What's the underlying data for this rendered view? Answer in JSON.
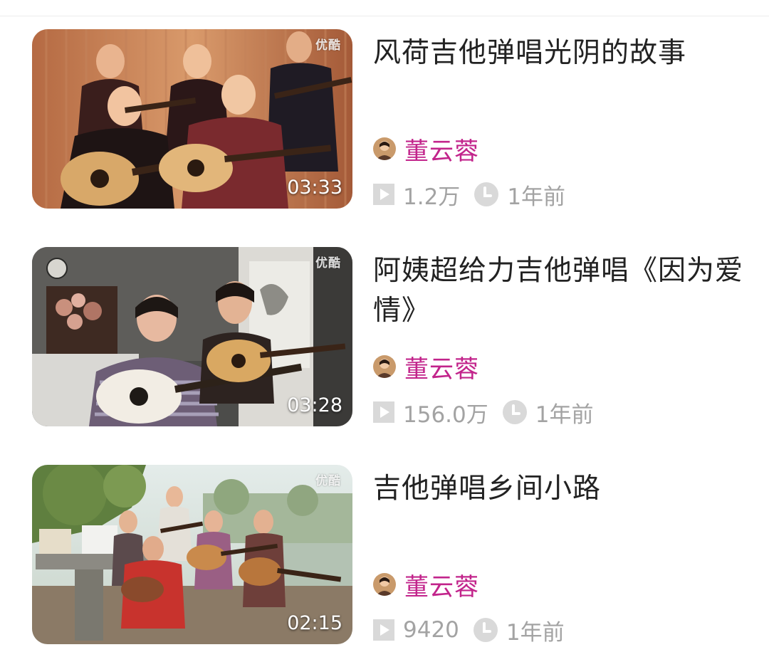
{
  "videos": [
    {
      "title": "风荷吉他弹唱光阴的故事",
      "author": "董云蓉",
      "views": "1.2万",
      "time_ago": "1年前",
      "duration": "03:33",
      "watermark": "优酷",
      "thumbnail_icon": "band-room-curtain-thumbnail"
    },
    {
      "title": "阿姨超给力吉他弹唱《因为爱情》",
      "author": "董云蓉",
      "views": "156.0万",
      "time_ago": "1年前",
      "duration": "03:28",
      "watermark": "优酷",
      "thumbnail_icon": "living-room-duet-thumbnail"
    },
    {
      "title": "吉他弹唱乡间小路",
      "author": "董云蓉",
      "views": "9420",
      "time_ago": "1年前",
      "duration": "02:15",
      "watermark": "优酷",
      "thumbnail_icon": "outdoor-riverside-thumbnail"
    }
  ],
  "colors": {
    "author": "#c2248b",
    "title": "#222222",
    "meta": "#a3a3a3",
    "icon_bg": "#d9d9d9"
  },
  "icons": {
    "views": "play-icon",
    "time": "clock-icon",
    "author": "avatar"
  }
}
